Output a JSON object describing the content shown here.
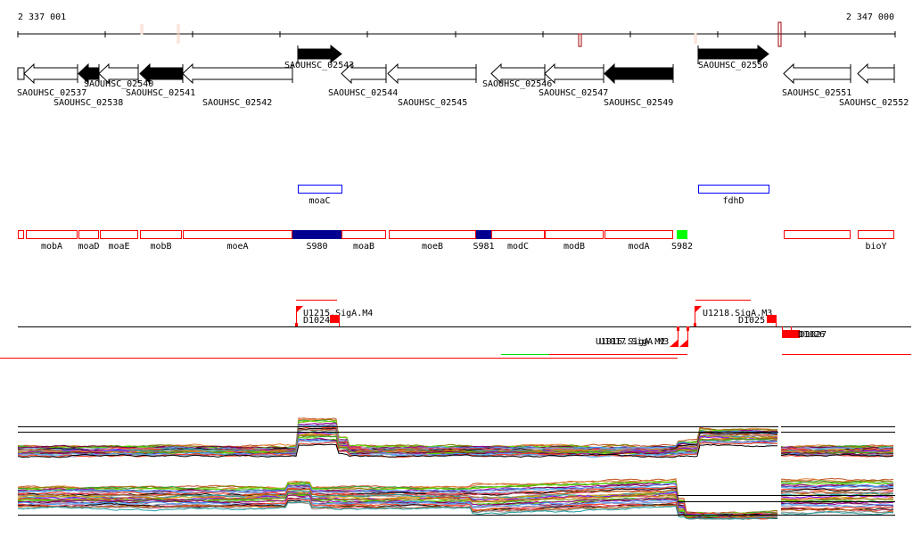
{
  "ruler": {
    "start_label": "2 337 001",
    "end_label": "2 347 000"
  },
  "genes": [
    {
      "label": "",
      "strand": "none",
      "fill": "white"
    },
    {
      "label": "SAOUHSC_02537",
      "strand": "-",
      "fill": "white"
    },
    {
      "label": "SAOUHSC_02538",
      "strand": "-",
      "fill": "black"
    },
    {
      "label": "SAOUHSC_02540",
      "strand": "-",
      "fill": "white"
    },
    {
      "label": "SAOUHSC_02541",
      "strand": "-",
      "fill": "black"
    },
    {
      "label": "SAOUHSC_02542",
      "strand": "-",
      "fill": "white"
    },
    {
      "label": "SAOUHSC_02543",
      "strand": "+",
      "fill": "black"
    },
    {
      "label": "SAOUHSC_02544",
      "strand": "-",
      "fill": "white"
    },
    {
      "label": "SAOUHSC_02545",
      "strand": "-",
      "fill": "white"
    },
    {
      "label": "SAOUHSC_02546",
      "strand": "-",
      "fill": "white"
    },
    {
      "label": "SAOUHSC_02547",
      "strand": "-",
      "fill": "white"
    },
    {
      "label": "SAOUHSC_02549",
      "strand": "-",
      "fill": "black"
    },
    {
      "label": "SAOUHSC_02550",
      "strand": "+",
      "fill": "black"
    },
    {
      "label": "SAOUHSC_02551",
      "strand": "-",
      "fill": "white"
    },
    {
      "label": "SAOUHSC_02552",
      "strand": "-",
      "fill": "white"
    }
  ],
  "upper_features": [
    {
      "label": "moaC",
      "color": "#0000ff"
    },
    {
      "label": "fdhD",
      "color": "#0000ff"
    }
  ],
  "features": [
    {
      "label": "",
      "type": "gene"
    },
    {
      "label": "mobA",
      "type": "gene"
    },
    {
      "label": "moaD",
      "type": "gene"
    },
    {
      "label": "moaE",
      "type": "gene"
    },
    {
      "label": "mobB",
      "type": "gene"
    },
    {
      "label": "moeA",
      "type": "gene"
    },
    {
      "label": "S980",
      "type": "srna"
    },
    {
      "label": "moaB",
      "type": "gene"
    },
    {
      "label": "moeB",
      "type": "gene"
    },
    {
      "label": "S981",
      "type": "srna"
    },
    {
      "label": "modC",
      "type": "gene"
    },
    {
      "label": "modB",
      "type": "gene"
    },
    {
      "label": "modA",
      "type": "gene"
    },
    {
      "label": "S982",
      "type": "srna-green"
    },
    {
      "label": "",
      "type": "gene"
    },
    {
      "label": "bioY",
      "type": "gene"
    }
  ],
  "feature_colors": {
    "gene": "#ff0000",
    "srna": "#000090",
    "srna-green": "#00ff00",
    "upper": "#0000ff"
  },
  "annotations": {
    "promoters": [
      {
        "label": "U1215.SigA.M4"
      },
      {
        "label": "U1218.SigA.M3"
      },
      {
        "label": "U1016.SigA.M2"
      },
      {
        "label": "U1017.SigA.M3"
      }
    ],
    "terminators": [
      {
        "label": "D1024"
      },
      {
        "label": "D1025"
      },
      {
        "label": "D1026"
      },
      {
        "label": "D1027"
      }
    ],
    "color": "#ff0000"
  },
  "expression_panels": [
    "top",
    "bottom"
  ]
}
